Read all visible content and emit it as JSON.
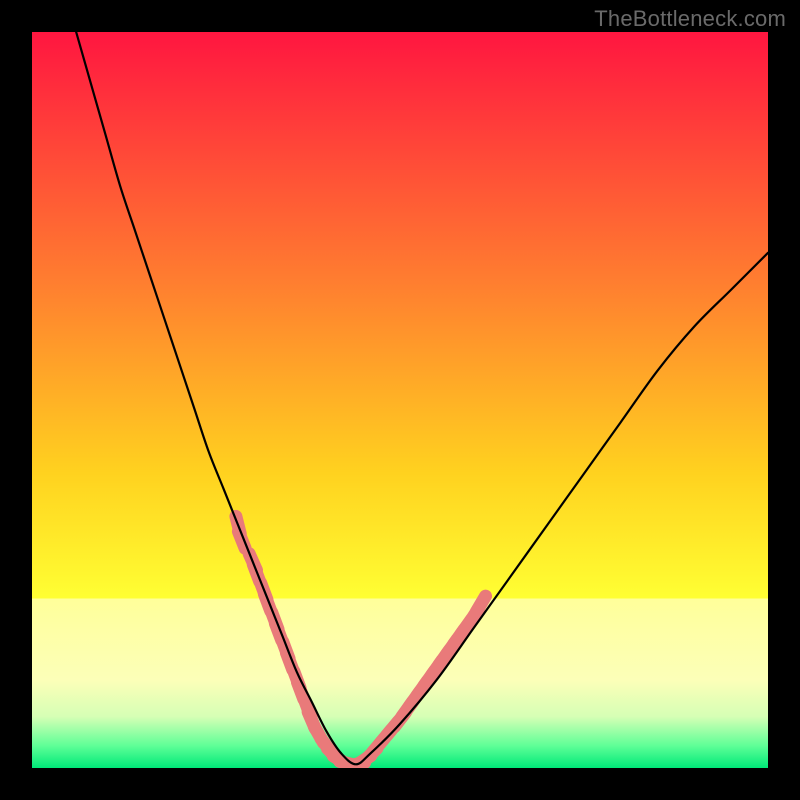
{
  "watermark": "TheBottleneck.com",
  "chart_data": {
    "type": "line",
    "title": "",
    "xlabel": "",
    "ylabel": "",
    "xlim": [
      0,
      100
    ],
    "ylim": [
      0,
      100
    ],
    "series": [
      {
        "name": "bottleneck-curve",
        "x": [
          6,
          8,
          10,
          12,
          14,
          16,
          18,
          20,
          22,
          24,
          26,
          28,
          30,
          32,
          34,
          36,
          38,
          40,
          42,
          44,
          46,
          50,
          55,
          60,
          65,
          70,
          75,
          80,
          85,
          90,
          95,
          100
        ],
        "y": [
          100,
          93,
          86,
          79,
          73,
          67,
          61,
          55,
          49,
          43,
          38,
          33,
          28,
          23,
          18,
          13,
          9,
          5,
          2,
          0.5,
          2,
          6,
          12,
          19,
          26,
          33,
          40,
          47,
          54,
          60,
          65,
          70
        ]
      }
    ],
    "highlight_band": {
      "ymin": 0,
      "ymax": 23
    },
    "valley_band": {
      "ymin": 0,
      "ymax": 3
    },
    "markers": {
      "name": "highlight-dots",
      "color": "#e97a7a",
      "points": [
        {
          "x": 28,
          "y": 33
        },
        {
          "x": 28.5,
          "y": 31
        },
        {
          "x": 30,
          "y": 28
        },
        {
          "x": 30.5,
          "y": 26.5
        },
        {
          "x": 31.5,
          "y": 24
        },
        {
          "x": 32,
          "y": 22.5
        },
        {
          "x": 33,
          "y": 20
        },
        {
          "x": 33.5,
          "y": 18.5
        },
        {
          "x": 34.5,
          "y": 16
        },
        {
          "x": 35,
          "y": 14.5
        },
        {
          "x": 36,
          "y": 12
        },
        {
          "x": 36.5,
          "y": 10.5
        },
        {
          "x": 37.5,
          "y": 8
        },
        {
          "x": 38,
          "y": 6.5
        },
        {
          "x": 39,
          "y": 4.5
        },
        {
          "x": 40,
          "y": 3
        },
        {
          "x": 41,
          "y": 1.8
        },
        {
          "x": 42,
          "y": 1
        },
        {
          "x": 43,
          "y": 0.6
        },
        {
          "x": 44,
          "y": 0.5
        },
        {
          "x": 45,
          "y": 1
        },
        {
          "x": 46,
          "y": 1.8
        },
        {
          "x": 47,
          "y": 3
        },
        {
          "x": 48,
          "y": 4.2
        },
        {
          "x": 49,
          "y": 5.4
        },
        {
          "x": 50,
          "y": 6.6
        },
        {
          "x": 51,
          "y": 8
        },
        {
          "x": 52,
          "y": 9.4
        },
        {
          "x": 53,
          "y": 10.8
        },
        {
          "x": 54,
          "y": 12.2
        },
        {
          "x": 55,
          "y": 13.6
        },
        {
          "x": 56,
          "y": 15
        },
        {
          "x": 57,
          "y": 16.4
        },
        {
          "x": 58,
          "y": 17.8
        },
        {
          "x": 59,
          "y": 19.2
        },
        {
          "x": 60,
          "y": 20.6
        },
        {
          "x": 61,
          "y": 22.3
        }
      ]
    },
    "gradient_stops": [
      {
        "offset": 0,
        "color": "#ff1640"
      },
      {
        "offset": 35,
        "color": "#ff812f"
      },
      {
        "offset": 60,
        "color": "#ffd21f"
      },
      {
        "offset": 77,
        "color": "#ffff33"
      },
      {
        "offset": 77,
        "color": "#ffff9a"
      },
      {
        "offset": 88,
        "color": "#fcffb8"
      },
      {
        "offset": 93,
        "color": "#d6ffb5"
      },
      {
        "offset": 97,
        "color": "#5eff97"
      },
      {
        "offset": 100,
        "color": "#00e878"
      }
    ]
  }
}
